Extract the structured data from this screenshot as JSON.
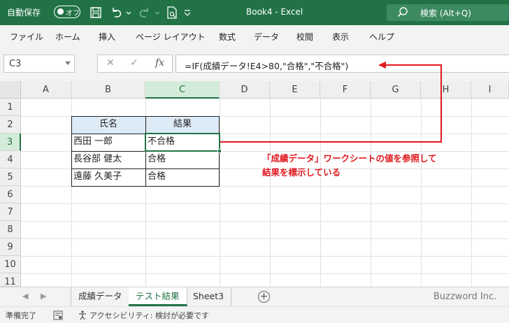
{
  "titlebar": {
    "autosave_label": "自動保存",
    "autosave_state": "オフ",
    "doc_title": "Book4  -  Excel",
    "search_label": "検索 (Alt+Q)"
  },
  "menu": [
    "ファイル",
    "ホーム",
    "挿入",
    "ページ レイアウト",
    "数式",
    "データ",
    "校閲",
    "表示",
    "ヘルプ"
  ],
  "formula_bar": {
    "name_box": "C3",
    "formula": "=IF(成績データ!E4>80,\"合格\",\"不合格\")"
  },
  "grid": {
    "columns": [
      "A",
      "B",
      "C",
      "D",
      "E",
      "F",
      "G",
      "H",
      "I"
    ],
    "rows": [
      "1",
      "2",
      "3",
      "4",
      "5",
      "6",
      "7",
      "8",
      "9",
      "10",
      "11"
    ],
    "selected_column": "C",
    "selected_row": "3",
    "table": {
      "headers": [
        "氏名",
        "結果"
      ],
      "rows": [
        [
          "西田 一郎",
          "不合格"
        ],
        [
          "長谷部 健太",
          "合格"
        ],
        [
          "遠藤 久美子",
          "合格"
        ]
      ]
    }
  },
  "annotation": {
    "line1": "「成績データ」ワークシートの値を参照して",
    "line2": "結果を標示している",
    "color": "#e0191f"
  },
  "sheet_tabs": {
    "tabs": [
      "成績データ",
      "テスト結果",
      "Sheet3"
    ],
    "active": "テスト結果"
  },
  "watermark": "Buzzword Inc.",
  "status_bar": {
    "ready": "準備完了",
    "accessibility": "アクセシビリティ: 検討が必要です"
  },
  "colors": {
    "excel_green": "#217346",
    "header_fill": "#ddebf7"
  }
}
